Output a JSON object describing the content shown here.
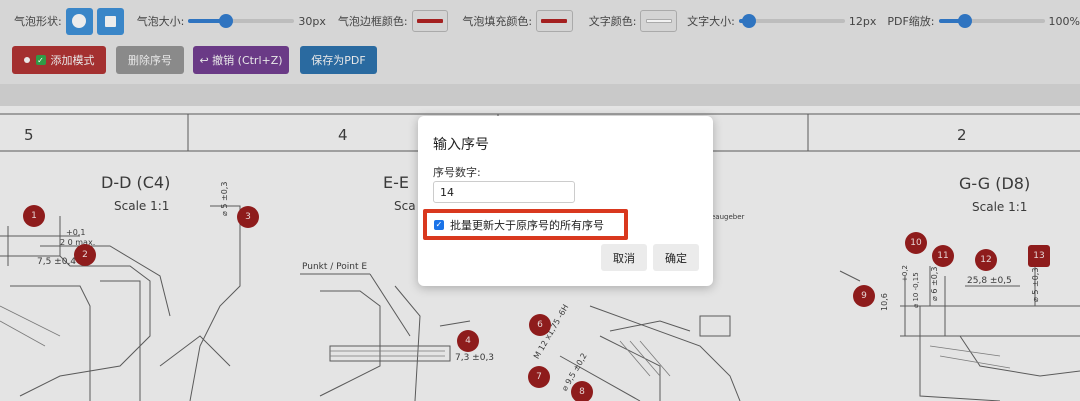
{
  "toolbar": {
    "shape_label": "气泡形状:",
    "bubble_size_label": "气泡大小:",
    "bubble_size_value": "30px",
    "bubble_size_level": 0.35,
    "border_color_label": "气泡边框颜色:",
    "border_color": "#a42020",
    "fill_color_label": "气泡填充颜色:",
    "fill_color": "#a42020",
    "text_color_label": "文字颜色:",
    "text_color": "#f2f2f2",
    "text_size_label": "文字大小:",
    "text_size_value": "12px",
    "text_size_level": 0.1,
    "pdf_zoom_label": "PDF缩放:",
    "pdf_zoom_value": "100%",
    "pdf_zoom_level": 0.25,
    "shape_icons": [
      "circle-icon",
      "square-icon"
    ]
  },
  "actions": {
    "add_mode": "添加模式",
    "delete_seq": "删除序号",
    "undo": "↩ 撤销 (Ctrl+Z)",
    "save_pdf": "保存为PDF"
  },
  "drawing": {
    "col_numbers": [
      "5",
      "4",
      "2"
    ],
    "section_dd": "D-D (C4)",
    "section_e": "E-E",
    "section_gg": "G-G (D8)",
    "scale": "Scale 1:1",
    "scale_partial": "Sca",
    "punkt": "Punkt / Point E",
    "augeber": "eaugeber",
    "dims": {
      "d_tol": "+0,1",
      "d_max": "2  0  max.",
      "d75": "7,5 ±0,4",
      "d5": "⌀ 5 ±0,3",
      "d73": "7,3 ±0,3",
      "m12": "M 12 x1,75 -6H",
      "d95": "⌀ 9,5 ±0,2",
      "d106": "10,6",
      "d10": "⌀ 10 -0,15",
      "d10tol": "+0,2",
      "d6": "⌀ 6 ±0,3",
      "d258": "25,8 ±0,5",
      "dg5": "⌀ 5 ±0,3"
    },
    "markers": [
      "1",
      "2",
      "3",
      "4",
      "6",
      "7",
      "8",
      "9",
      "10",
      "11",
      "12",
      "13"
    ]
  },
  "dialog": {
    "title": "输入序号",
    "label": "序号数字:",
    "input_value": "14",
    "checkbox_label": "批量更新大于原序号的所有序号",
    "cancel": "取消",
    "ok": "确定"
  }
}
